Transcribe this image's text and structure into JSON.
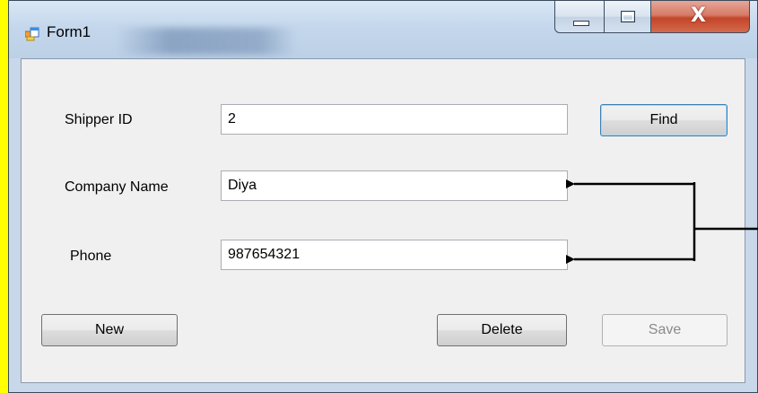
{
  "window": {
    "title": "Form1",
    "icon": "form-icon"
  },
  "caption_buttons": {
    "minimize_icon": "minimize-icon",
    "maximize_icon": "maximize-icon",
    "close_glyph": "X"
  },
  "form": {
    "shipper_id": {
      "label": "Shipper ID",
      "value": "2"
    },
    "company_name": {
      "label": "Company Name",
      "value": "Diya"
    },
    "phone": {
      "label": "Phone",
      "value": "987654321"
    }
  },
  "buttons": {
    "find": "Find",
    "new": "New",
    "delete": "Delete",
    "save": "Save"
  },
  "colors": {
    "background": "#FFFF00",
    "form_background": "#F0F0F0",
    "annotation": "#000000"
  }
}
